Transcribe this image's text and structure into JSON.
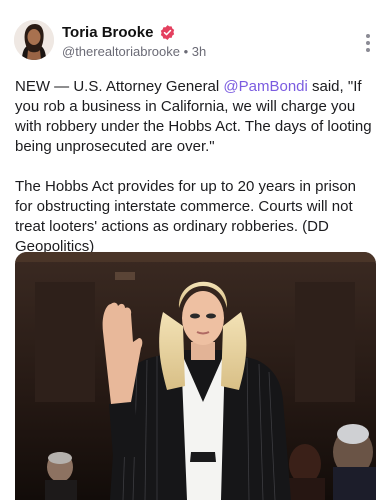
{
  "post": {
    "author": {
      "display_name": "Toria Brooke",
      "handle": "@therealtoriabrooke",
      "separator": "•",
      "time": "3h",
      "verified_icon": "verified-badge-icon",
      "verified_color": "#e4405f"
    },
    "more_icon": "vertical-ellipsis-icon",
    "text": {
      "p1_before": "NEW — U.S. Attorney General ",
      "mention": "@PamBondi",
      "p1_after": " said, \"If you rob a business in California, we will charge you with robbery under the Hobbs Act. The days of looting being unprosecuted are over.\"",
      "p2": "The Hobbs Act provides for up to 20 years in prison for obstructing interstate commerce. Courts will not treat looters' actions as ordinary robberies. (DD Geopolitics)"
    },
    "media": {
      "kind": "photo",
      "description_icon": "photo-woman-raising-hand-icon"
    }
  },
  "colors": {
    "mention": "#7b5ce0",
    "text": "#1c1c1f",
    "secondary": "#6b6b76"
  }
}
